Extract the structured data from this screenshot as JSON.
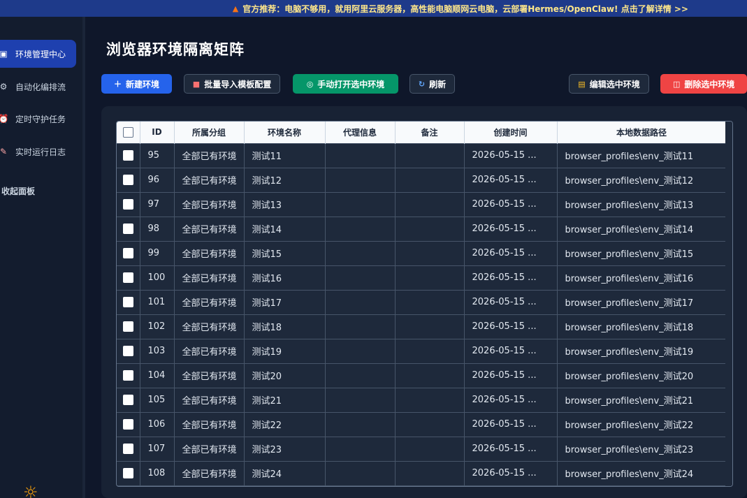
{
  "banner": {
    "text": "官方推荐：电脑不够用，就用阿里云服务器，高性能电脑顺网云电脑，云部署Hermes/OpenClaw! 点击了解详情 >>"
  },
  "sidebar": {
    "items": [
      {
        "label": "环境管理中心",
        "icon": "laptop-icon"
      },
      {
        "label": "自动化编排流",
        "icon": "gear-icon"
      },
      {
        "label": "定时守护任务",
        "icon": "alarm-clock-icon"
      },
      {
        "label": "实时运行日志",
        "icon": "memo-icon"
      }
    ],
    "collapse_label": "收起面板",
    "theme_icon": "sun-icon"
  },
  "page": {
    "title": "浏览器环境隔离矩阵"
  },
  "toolbar": {
    "new_label": "新建环境",
    "import_label": "批量导入模板配置",
    "open_label": "手动打开选中环境",
    "refresh_label": "刷新",
    "edit_label": "编辑选中环境",
    "delete_label": "删除选中环境"
  },
  "table": {
    "headers": [
      "ID",
      "所属分组",
      "环境名称",
      "代理信息",
      "备注",
      "创建时间",
      "本地数据路径"
    ],
    "rows": [
      [
        "95",
        "全部已有环境",
        "测试11",
        "",
        "",
        "2026-05-15 ...",
        "browser_profiles\\env_测试11"
      ],
      [
        "96",
        "全部已有环境",
        "测试12",
        "",
        "",
        "2026-05-15 ...",
        "browser_profiles\\env_测试12"
      ],
      [
        "97",
        "全部已有环境",
        "测试13",
        "",
        "",
        "2026-05-15 ...",
        "browser_profiles\\env_测试13"
      ],
      [
        "98",
        "全部已有环境",
        "测试14",
        "",
        "",
        "2026-05-15 ...",
        "browser_profiles\\env_测试14"
      ],
      [
        "99",
        "全部已有环境",
        "测试15",
        "",
        "",
        "2026-05-15 ...",
        "browser_profiles\\env_测试15"
      ],
      [
        "100",
        "全部已有环境",
        "测试16",
        "",
        "",
        "2026-05-15 ...",
        "browser_profiles\\env_测试16"
      ],
      [
        "101",
        "全部已有环境",
        "测试17",
        "",
        "",
        "2026-05-15 ...",
        "browser_profiles\\env_测试17"
      ],
      [
        "102",
        "全部已有环境",
        "测试18",
        "",
        "",
        "2026-05-15 ...",
        "browser_profiles\\env_测试18"
      ],
      [
        "103",
        "全部已有环境",
        "测试19",
        "",
        "",
        "2026-05-15 ...",
        "browser_profiles\\env_测试19"
      ],
      [
        "104",
        "全部已有环境",
        "测试20",
        "",
        "",
        "2026-05-15 ...",
        "browser_profiles\\env_测试20"
      ],
      [
        "105",
        "全部已有环境",
        "测试21",
        "",
        "",
        "2026-05-15 ...",
        "browser_profiles\\env_测试21"
      ],
      [
        "106",
        "全部已有环境",
        "测试22",
        "",
        "",
        "2026-05-15 ...",
        "browser_profiles\\env_测试22"
      ],
      [
        "107",
        "全部已有环境",
        "测试23",
        "",
        "",
        "2026-05-15 ...",
        "browser_profiles\\env_测试23"
      ],
      [
        "108",
        "全部已有环境",
        "测试24",
        "",
        "",
        "2026-05-15 ...",
        "browser_profiles\\env_测试24"
      ],
      [
        "",
        "",
        "",
        "",
        "",
        "",
        ""
      ]
    ]
  }
}
